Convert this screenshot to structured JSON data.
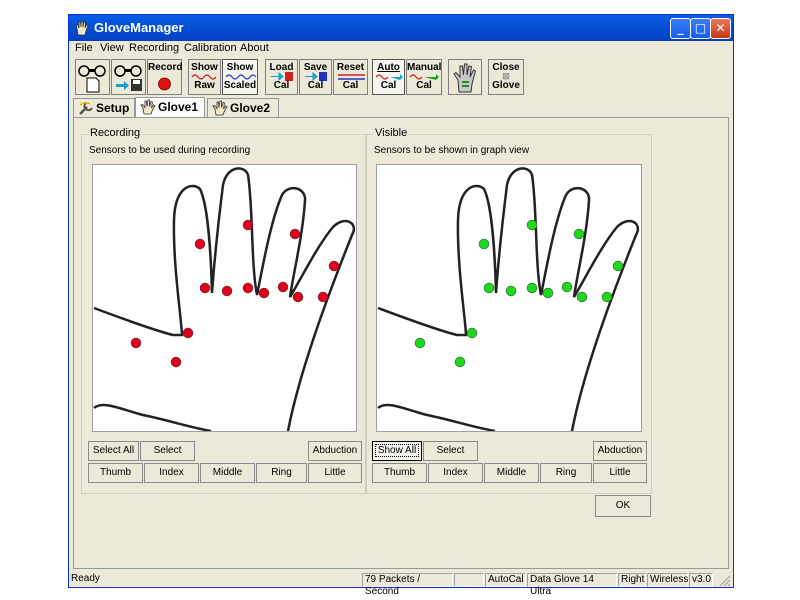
{
  "window": {
    "title": "GloveManager",
    "minimize": "_",
    "maximize": "□",
    "close": "✕"
  },
  "menu": [
    "File",
    "View",
    "Recording",
    "Calibration",
    "About"
  ],
  "toolbar": {
    "record": "Record",
    "show_raw": [
      "Show",
      "Raw"
    ],
    "show_scaled": [
      "Show",
      "Scaled"
    ],
    "load_cal": [
      "Load",
      "Cal"
    ],
    "save_cal": [
      "Save",
      "Cal"
    ],
    "reset_cal": [
      "Reset",
      "Cal"
    ],
    "auto_cal": [
      "Auto",
      "Cal"
    ],
    "manual_cal": [
      "Manual",
      "Cal"
    ],
    "close_glove": [
      "Close",
      "Glove"
    ]
  },
  "tabs": [
    "Setup",
    "Glove1",
    "Glove2"
  ],
  "recording": {
    "legend": "Recording",
    "description": "Sensors to be used during recording",
    "sensor_color": "#e0001b",
    "buttons": {
      "select_all": "Select All",
      "select_none": "Select None",
      "abduction": "Abduction"
    },
    "fingers": [
      "Thumb",
      "Index",
      "Middle",
      "Ring",
      "Little"
    ]
  },
  "visible": {
    "legend": "Visible",
    "description": "Sensors to be shown in graph view",
    "sensor_color": "#1ed81e",
    "buttons": {
      "show_all": "Show All",
      "select_none": "Select None",
      "abduction": "Abduction"
    },
    "fingers": [
      "Thumb",
      "Index",
      "Middle",
      "Ring",
      "Little"
    ]
  },
  "ok": "OK",
  "status": {
    "text": "Ready",
    "packets": "79 Packets / Second",
    "autocal": "AutoCal",
    "glove": "Data Glove 14 Ultra",
    "hand": "Right",
    "conn": "Wireless",
    "version": "v3.0"
  }
}
